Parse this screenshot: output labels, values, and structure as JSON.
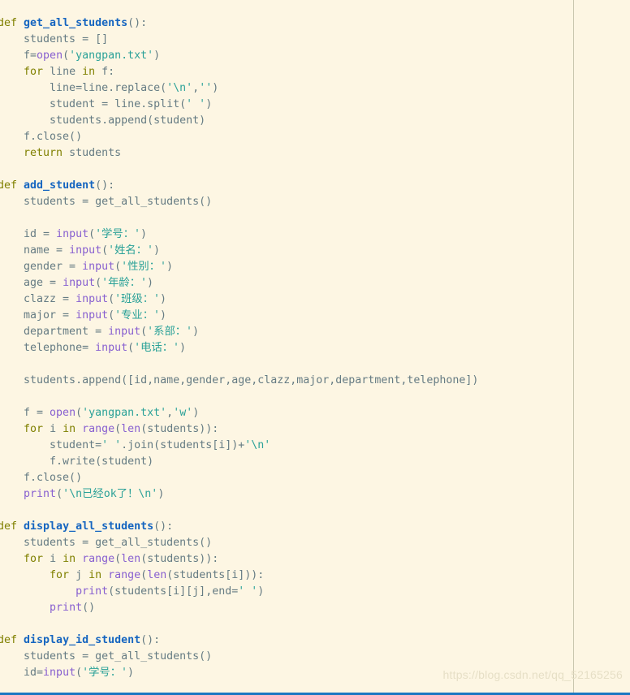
{
  "editor": {
    "background_color": "#fdf6e3",
    "default_text_color": "#657b83",
    "bottom_border_color": "#1a78c2",
    "ruler_color": "#c9c6ae",
    "theme_name": "solarized-light"
  },
  "syntax_colors": {
    "keyword": "#808000",
    "function_name": "#1565c0",
    "builtin": "#8860d0",
    "string": "#2aa198",
    "identifier": "#657b83"
  },
  "watermark": {
    "text": "https://blog.csdn.net/qq_52165256",
    "color": "#e6dfc6"
  },
  "code": {
    "language": "python",
    "lines": [
      [
        {
          "t": "def ",
          "c": "kw"
        },
        {
          "t": "get_all_students",
          "c": "fn"
        },
        {
          "t": "():",
          "c": "id"
        }
      ],
      [
        {
          "t": "    students = []",
          "c": "id"
        }
      ],
      [
        {
          "t": "    f=",
          "c": "id"
        },
        {
          "t": "open",
          "c": "bi"
        },
        {
          "t": "(",
          "c": "id"
        },
        {
          "t": "'yangpan.txt'",
          "c": "str"
        },
        {
          "t": ")",
          "c": "id"
        }
      ],
      [
        {
          "t": "    ",
          "c": "id"
        },
        {
          "t": "for",
          "c": "kw"
        },
        {
          "t": " line ",
          "c": "id"
        },
        {
          "t": "in",
          "c": "kw"
        },
        {
          "t": " f:",
          "c": "id"
        }
      ],
      [
        {
          "t": "        line=line.replace(",
          "c": "id"
        },
        {
          "t": "'\\n'",
          "c": "str"
        },
        {
          "t": ",",
          "c": "id"
        },
        {
          "t": "''",
          "c": "str"
        },
        {
          "t": ")",
          "c": "id"
        }
      ],
      [
        {
          "t": "        student = line.split(",
          "c": "id"
        },
        {
          "t": "' '",
          "c": "str"
        },
        {
          "t": ")",
          "c": "id"
        }
      ],
      [
        {
          "t": "        students.append(student)",
          "c": "id"
        }
      ],
      [
        {
          "t": "    f.close()",
          "c": "id"
        }
      ],
      [
        {
          "t": "    ",
          "c": "id"
        },
        {
          "t": "return",
          "c": "kw"
        },
        {
          "t": " students",
          "c": "id"
        }
      ],
      [
        {
          "t": "",
          "c": "id"
        }
      ],
      [
        {
          "t": "def ",
          "c": "kw"
        },
        {
          "t": "add_student",
          "c": "fn"
        },
        {
          "t": "():",
          "c": "id"
        }
      ],
      [
        {
          "t": "    students = get_all_students()",
          "c": "id"
        }
      ],
      [
        {
          "t": "",
          "c": "id"
        }
      ],
      [
        {
          "t": "    id = ",
          "c": "id"
        },
        {
          "t": "input",
          "c": "bi"
        },
        {
          "t": "(",
          "c": "id"
        },
        {
          "t": "'学号：'",
          "c": "str"
        },
        {
          "t": ")",
          "c": "id"
        }
      ],
      [
        {
          "t": "    name = ",
          "c": "id"
        },
        {
          "t": "input",
          "c": "bi"
        },
        {
          "t": "(",
          "c": "id"
        },
        {
          "t": "'姓名：'",
          "c": "str"
        },
        {
          "t": ")",
          "c": "id"
        }
      ],
      [
        {
          "t": "    gender = ",
          "c": "id"
        },
        {
          "t": "input",
          "c": "bi"
        },
        {
          "t": "(",
          "c": "id"
        },
        {
          "t": "'性别：'",
          "c": "str"
        },
        {
          "t": ")",
          "c": "id"
        }
      ],
      [
        {
          "t": "    age = ",
          "c": "id"
        },
        {
          "t": "input",
          "c": "bi"
        },
        {
          "t": "(",
          "c": "id"
        },
        {
          "t": "'年龄：'",
          "c": "str"
        },
        {
          "t": ")",
          "c": "id"
        }
      ],
      [
        {
          "t": "    clazz = ",
          "c": "id"
        },
        {
          "t": "input",
          "c": "bi"
        },
        {
          "t": "(",
          "c": "id"
        },
        {
          "t": "'班级：'",
          "c": "str"
        },
        {
          "t": ")",
          "c": "id"
        }
      ],
      [
        {
          "t": "    major = ",
          "c": "id"
        },
        {
          "t": "input",
          "c": "bi"
        },
        {
          "t": "(",
          "c": "id"
        },
        {
          "t": "'专业：'",
          "c": "str"
        },
        {
          "t": ")",
          "c": "id"
        }
      ],
      [
        {
          "t": "    department = ",
          "c": "id"
        },
        {
          "t": "input",
          "c": "bi"
        },
        {
          "t": "(",
          "c": "id"
        },
        {
          "t": "'系部：'",
          "c": "str"
        },
        {
          "t": ")",
          "c": "id"
        }
      ],
      [
        {
          "t": "    telephone= ",
          "c": "id"
        },
        {
          "t": "input",
          "c": "bi"
        },
        {
          "t": "(",
          "c": "id"
        },
        {
          "t": "'电话：'",
          "c": "str"
        },
        {
          "t": ")",
          "c": "id"
        }
      ],
      [
        {
          "t": "",
          "c": "id"
        }
      ],
      [
        {
          "t": "    students.append([id,name,gender,age,clazz,major,department,telephone])",
          "c": "id"
        }
      ],
      [
        {
          "t": "",
          "c": "id"
        }
      ],
      [
        {
          "t": "    f = ",
          "c": "id"
        },
        {
          "t": "open",
          "c": "bi"
        },
        {
          "t": "(",
          "c": "id"
        },
        {
          "t": "'yangpan.txt'",
          "c": "str"
        },
        {
          "t": ",",
          "c": "id"
        },
        {
          "t": "'w'",
          "c": "str"
        },
        {
          "t": ")",
          "c": "id"
        }
      ],
      [
        {
          "t": "    ",
          "c": "id"
        },
        {
          "t": "for",
          "c": "kw"
        },
        {
          "t": " i ",
          "c": "id"
        },
        {
          "t": "in",
          "c": "kw"
        },
        {
          "t": " ",
          "c": "id"
        },
        {
          "t": "range",
          "c": "bi"
        },
        {
          "t": "(",
          "c": "id"
        },
        {
          "t": "len",
          "c": "bi"
        },
        {
          "t": "(students)):",
          "c": "id"
        }
      ],
      [
        {
          "t": "        student=",
          "c": "id"
        },
        {
          "t": "' '",
          "c": "str"
        },
        {
          "t": ".join(students[i])+",
          "c": "id"
        },
        {
          "t": "'\\n'",
          "c": "str"
        }
      ],
      [
        {
          "t": "        f.write(student)",
          "c": "id"
        }
      ],
      [
        {
          "t": "    f.close()",
          "c": "id"
        }
      ],
      [
        {
          "t": "    ",
          "c": "id"
        },
        {
          "t": "print",
          "c": "bi"
        },
        {
          "t": "(",
          "c": "id"
        },
        {
          "t": "'\\n已经ok了！\\n'",
          "c": "str"
        },
        {
          "t": ")",
          "c": "id"
        }
      ],
      [
        {
          "t": "",
          "c": "id"
        }
      ],
      [
        {
          "t": "def ",
          "c": "kw"
        },
        {
          "t": "display_all_students",
          "c": "fn"
        },
        {
          "t": "():",
          "c": "id"
        }
      ],
      [
        {
          "t": "    students = get_all_students()",
          "c": "id"
        }
      ],
      [
        {
          "t": "    ",
          "c": "id"
        },
        {
          "t": "for",
          "c": "kw"
        },
        {
          "t": " i ",
          "c": "id"
        },
        {
          "t": "in",
          "c": "kw"
        },
        {
          "t": " ",
          "c": "id"
        },
        {
          "t": "range",
          "c": "bi"
        },
        {
          "t": "(",
          "c": "id"
        },
        {
          "t": "len",
          "c": "bi"
        },
        {
          "t": "(students)):",
          "c": "id"
        }
      ],
      [
        {
          "t": "        ",
          "c": "id"
        },
        {
          "t": "for",
          "c": "kw"
        },
        {
          "t": " j ",
          "c": "id"
        },
        {
          "t": "in",
          "c": "kw"
        },
        {
          "t": " ",
          "c": "id"
        },
        {
          "t": "range",
          "c": "bi"
        },
        {
          "t": "(",
          "c": "id"
        },
        {
          "t": "len",
          "c": "bi"
        },
        {
          "t": "(students[i])):",
          "c": "id"
        }
      ],
      [
        {
          "t": "            ",
          "c": "id"
        },
        {
          "t": "print",
          "c": "bi"
        },
        {
          "t": "(students[i][j],end=",
          "c": "id"
        },
        {
          "t": "' '",
          "c": "str"
        },
        {
          "t": ")",
          "c": "id"
        }
      ],
      [
        {
          "t": "        ",
          "c": "id"
        },
        {
          "t": "print",
          "c": "bi"
        },
        {
          "t": "()",
          "c": "id"
        }
      ],
      [
        {
          "t": "",
          "c": "id"
        }
      ],
      [
        {
          "t": "def ",
          "c": "kw"
        },
        {
          "t": "display_id_student",
          "c": "fn"
        },
        {
          "t": "():",
          "c": "id"
        }
      ],
      [
        {
          "t": "    students = get_all_students()",
          "c": "id"
        }
      ],
      [
        {
          "t": "    id=",
          "c": "id"
        },
        {
          "t": "input",
          "c": "bi"
        },
        {
          "t": "(",
          "c": "id"
        },
        {
          "t": "'学号：'",
          "c": "str"
        },
        {
          "t": ")",
          "c": "id"
        }
      ]
    ]
  }
}
